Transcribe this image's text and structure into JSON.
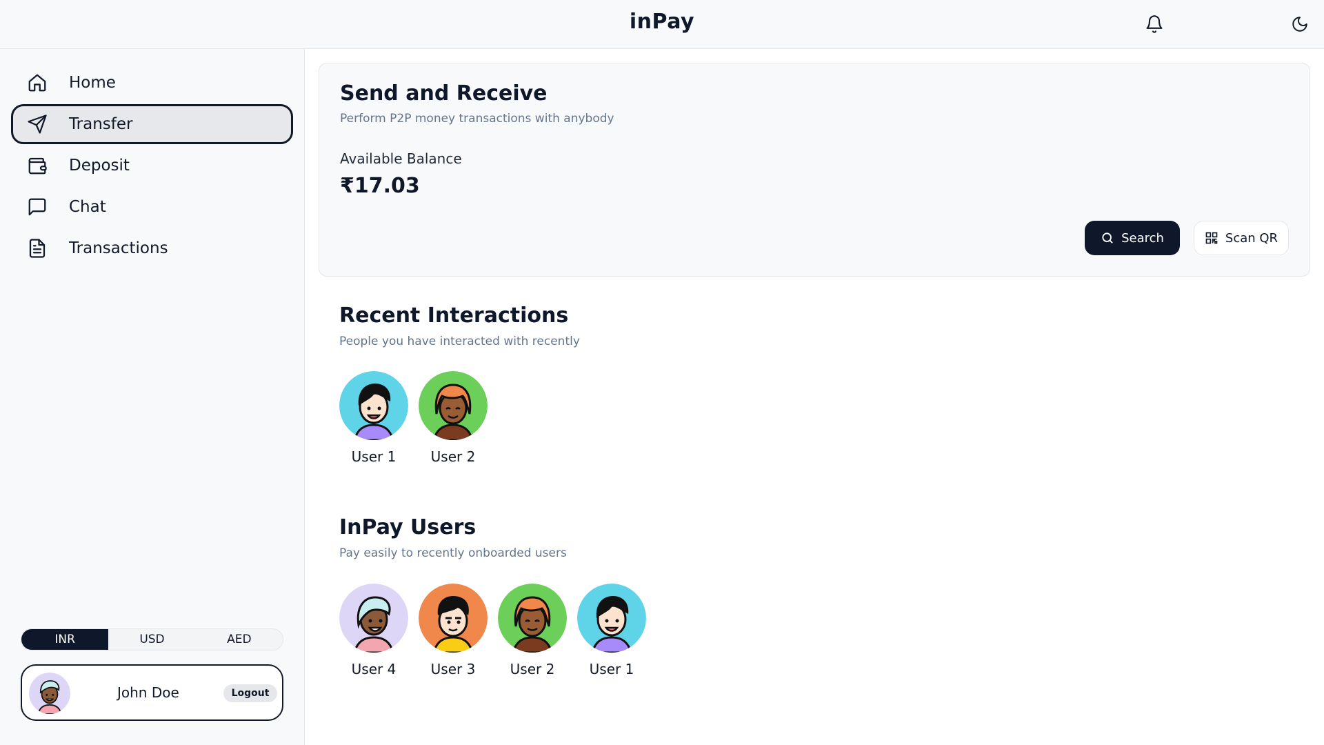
{
  "header": {
    "title": "inPay",
    "icons": [
      "bell-icon",
      "moon-icon"
    ]
  },
  "sidebar": {
    "items": [
      {
        "label": "Home",
        "icon": "home-icon"
      },
      {
        "label": "Transfer",
        "icon": "send-icon",
        "active": true
      },
      {
        "label": "Deposit",
        "icon": "wallet-icon"
      },
      {
        "label": "Chat",
        "icon": "chat-icon"
      },
      {
        "label": "Transactions",
        "icon": "document-icon"
      }
    ],
    "currency": {
      "options": [
        "INR",
        "USD",
        "AED"
      ],
      "selected": "INR"
    },
    "profile": {
      "name": "John Doe",
      "logout_label": "Logout"
    }
  },
  "send_receive": {
    "title": "Send and Receive",
    "subtitle": "Perform P2P money transactions with anybody",
    "balance_label": "Available Balance",
    "balance_value": "₹17.03",
    "search_label": "Search",
    "scan_label": "Scan QR"
  },
  "recent": {
    "title": "Recent Interactions",
    "subtitle": "People you have interacted with recently",
    "users": [
      {
        "name": "User 1",
        "bg": "#5fd3e8"
      },
      {
        "name": "User 2",
        "bg": "#6ccf5a"
      }
    ]
  },
  "inpay_users": {
    "title": "InPay Users",
    "subtitle": "Pay easily to recently onboarded users",
    "users": [
      {
        "name": "User 4",
        "bg": "#ddd6f7"
      },
      {
        "name": "User 3",
        "bg": "#f0874b"
      },
      {
        "name": "User 2",
        "bg": "#6ccf5a"
      },
      {
        "name": "User 1",
        "bg": "#5fd3e8"
      }
    ]
  },
  "colors": {
    "primary": "#0f172a",
    "muted": "#64748b",
    "surface": "#f8f9fa"
  }
}
